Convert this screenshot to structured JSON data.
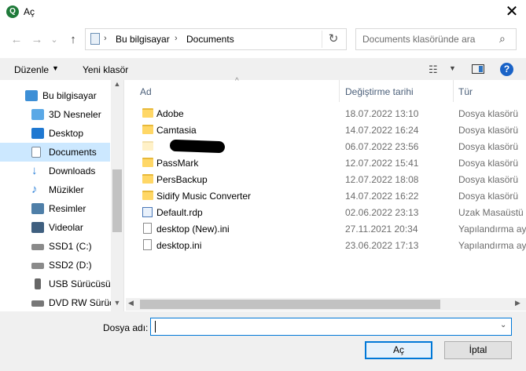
{
  "window": {
    "title": "Aç",
    "close_glyph": "✕",
    "app_icon_glyph": "Q"
  },
  "nav": {
    "back_glyph": "←",
    "forward_glyph": "→",
    "recent_glyph": "⌄",
    "up_glyph": "↑"
  },
  "address": {
    "sep": "›",
    "items": [
      "Bu bilgisayar",
      "Documents"
    ],
    "refresh_glyph": "↻"
  },
  "search": {
    "placeholder": "Documents klasöründe ara",
    "icon_glyph": "⌕"
  },
  "toolbar": {
    "organize": "Düzenle",
    "new_folder": "Yeni klasör",
    "caret": "▼",
    "view_glyph": "☷",
    "help_glyph": "?"
  },
  "sidebar": {
    "items": [
      {
        "label": "Bu bilgisayar",
        "icon": "computer-icon",
        "color": "#3d8fd6"
      },
      {
        "label": "3D Nesneler",
        "icon": "3d-objects-icon",
        "color": "#5aa8e6"
      },
      {
        "label": "Desktop",
        "icon": "desktop-icon",
        "color": "#1f78d1"
      },
      {
        "label": "Documents",
        "icon": "documents-icon",
        "color": "#7a8a99"
      },
      {
        "label": "Downloads",
        "icon": "downloads-icon",
        "color": "#2a7fd8"
      },
      {
        "label": "Müzikler",
        "icon": "music-icon",
        "color": "#2a7fd8"
      },
      {
        "label": "Resimler",
        "icon": "pictures-icon",
        "color": "#4f7fa8"
      },
      {
        "label": "Videolar",
        "icon": "videos-icon",
        "color": "#3f5f7f"
      },
      {
        "label": "SSD1 (C:)",
        "icon": "drive-icon",
        "color": "#8a8a8a"
      },
      {
        "label": "SSD2 (D:)",
        "icon": "drive-icon",
        "color": "#8a8a8a"
      },
      {
        "label": "USB Sürücüsü (",
        "icon": "usb-drive-icon",
        "color": "#666666"
      },
      {
        "label": "DVD RW Sürüc",
        "icon": "dvd-drive-icon",
        "color": "#777777"
      }
    ],
    "selected_index": 3,
    "scroll_up": "▲",
    "scroll_down": "▼"
  },
  "columns": {
    "name": "Ad",
    "date": "Değiştirme tarihi",
    "type": "Tür",
    "sort_glyph": "^"
  },
  "files": [
    {
      "name": "Adobe",
      "date": "18.07.2022 13:10",
      "type": "Dosya klasörü",
      "kind": "folder"
    },
    {
      "name": "Camtasia",
      "date": "14.07.2022 16:24",
      "type": "Dosya klasörü",
      "kind": "folder"
    },
    {
      "name": "",
      "date": "06.07.2022 23:56",
      "type": "Dosya klasörü",
      "kind": "folder-faded",
      "redacted": true
    },
    {
      "name": "PassMark",
      "date": "12.07.2022 15:41",
      "type": "Dosya klasörü",
      "kind": "folder"
    },
    {
      "name": "PersBackup",
      "date": "12.07.2022 18:08",
      "type": "Dosya klasörü",
      "kind": "folder"
    },
    {
      "name": "Sidify Music Converter",
      "date": "14.07.2022 16:22",
      "type": "Dosya klasörü",
      "kind": "folder"
    },
    {
      "name": "Default.rdp",
      "date": "02.06.2022 23:13",
      "type": "Uzak Masaüstü B",
      "kind": "rdp"
    },
    {
      "name": "desktop (New).ini",
      "date": "27.11.2021 20:34",
      "type": "Yapılandırma ay",
      "kind": "ini"
    },
    {
      "name": "desktop.ini",
      "date": "23.06.2022 17:13",
      "type": "Yapılandırma ay",
      "kind": "ini"
    }
  ],
  "hscroll": {
    "left": "◀",
    "right": "▶"
  },
  "footer": {
    "filename_label": "Dosya adı:",
    "filename_value": "",
    "dropdown_glyph": "⌄",
    "open": "Aç",
    "cancel": "İptal"
  }
}
